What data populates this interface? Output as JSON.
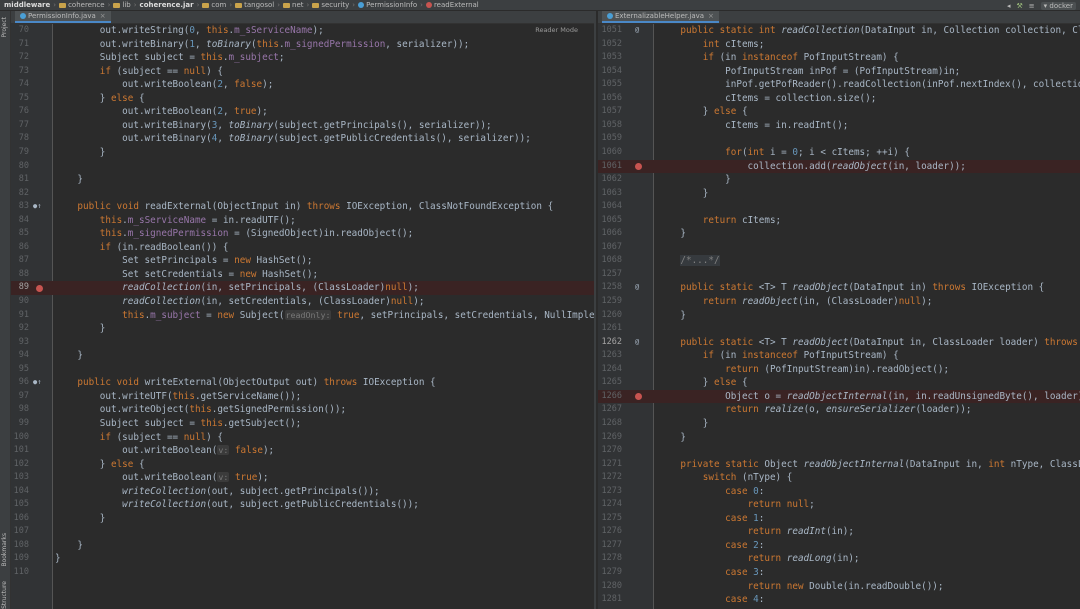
{
  "breadcrumb": [
    "middleware",
    "coherence",
    "lib",
    "coherence.jar",
    "com",
    "tangosol",
    "net",
    "security",
    "PermissionInfo",
    "readExternal"
  ],
  "topbar": {
    "run_config": "docker"
  },
  "side_tabs": {
    "project": "Project",
    "bookmarks": "Bookmarks",
    "structure": "Structure"
  },
  "left_tab": {
    "label": "PermissionInfo.java"
  },
  "right_tab": {
    "label": "ExternalizableHelper.java"
  },
  "reader_mode": "Reader Mode",
  "left_lines": [
    {
      "n": "70",
      "t": "        out.writeString(0, this.m_sServiceName);"
    },
    {
      "n": "71",
      "t": "        out.writeBinary(1, toBinary(this.m_signedPermission, serializer));"
    },
    {
      "n": "72",
      "t": "        Subject subject = this.m_subject;"
    },
    {
      "n": "73",
      "t": "        if (subject == null) {"
    },
    {
      "n": "74",
      "t": "            out.writeBoolean(2, false);"
    },
    {
      "n": "75",
      "t": "        } else {"
    },
    {
      "n": "76",
      "t": "            out.writeBoolean(2, true);"
    },
    {
      "n": "77",
      "t": "            out.writeBinary(3, toBinary(subject.getPrincipals(), serializer));"
    },
    {
      "n": "78",
      "t": "            out.writeBinary(4, toBinary(subject.getPublicCredentials(), serializer));"
    },
    {
      "n": "79",
      "t": "        }"
    },
    {
      "n": "80",
      "t": ""
    },
    {
      "n": "81",
      "t": "    }"
    },
    {
      "n": "82",
      "t": ""
    },
    {
      "n": "83",
      "t": "    public void readExternal(ObjectInput in) throws IOException, ClassNotFoundException {"
    },
    {
      "n": "84",
      "t": "        this.m_sServiceName = in.readUTF();"
    },
    {
      "n": "85",
      "t": "        this.m_signedPermission = (SignedObject)in.readObject();"
    },
    {
      "n": "86",
      "t": "        if (in.readBoolean()) {"
    },
    {
      "n": "87",
      "t": "            Set setPrincipals = new HashSet();"
    },
    {
      "n": "88",
      "t": "            Set setCredentials = new HashSet();"
    },
    {
      "n": "89",
      "t": "            readCollection(in, setPrincipals, (ClassLoader)null);"
    },
    {
      "n": "90",
      "t": "            readCollection(in, setCredentials, (ClassLoader)null);"
    },
    {
      "n": "91",
      "t": "            this.m_subject = new Subject( readOnly: true, setPrincipals, setCredentials, NullImplementa"
    },
    {
      "n": "92",
      "t": "        }"
    },
    {
      "n": "93",
      "t": ""
    },
    {
      "n": "94",
      "t": "    }"
    },
    {
      "n": "95",
      "t": ""
    },
    {
      "n": "96",
      "t": "    public void writeExternal(ObjectOutput out) throws IOException {"
    },
    {
      "n": "97",
      "t": "        out.writeUTF(this.getServiceName());"
    },
    {
      "n": "98",
      "t": "        out.writeObject(this.getSignedPermission());"
    },
    {
      "n": "99",
      "t": "        Subject subject = this.getSubject();"
    },
    {
      "n": "100",
      "t": "        if (subject == null) {"
    },
    {
      "n": "101",
      "t": "            out.writeBoolean( v: false);"
    },
    {
      "n": "102",
      "t": "        } else {"
    },
    {
      "n": "103",
      "t": "            out.writeBoolean( v: true);"
    },
    {
      "n": "104",
      "t": "            writeCollection(out, subject.getPrincipals());"
    },
    {
      "n": "105",
      "t": "            writeCollection(out, subject.getPublicCredentials());"
    },
    {
      "n": "106",
      "t": "        }"
    },
    {
      "n": "107",
      "t": ""
    },
    {
      "n": "108",
      "t": "    }"
    },
    {
      "n": "109",
      "t": "}"
    },
    {
      "n": "110",
      "t": ""
    }
  ],
  "right_lines": [
    {
      "n": "1051",
      "t": "    public static int readCollection(DataInput in, Collection collection, Cla"
    },
    {
      "n": "1052",
      "t": "        int cItems;"
    },
    {
      "n": "1053",
      "t": "        if (in instanceof PofInputStream) {"
    },
    {
      "n": "1054",
      "t": "            PofInputStream inPof = (PofInputStream)in;"
    },
    {
      "n": "1055",
      "t": "            inPof.getPofReader().readCollection(inPof.nextIndex(), collection);"
    },
    {
      "n": "1056",
      "t": "            cItems = collection.size();"
    },
    {
      "n": "1057",
      "t": "        } else {"
    },
    {
      "n": "1058",
      "t": "            cItems = in.readInt();"
    },
    {
      "n": "1059",
      "t": ""
    },
    {
      "n": "1060",
      "t": "            for(int i = 0; i < cItems; ++i) {"
    },
    {
      "n": "1061",
      "t": "                collection.add(readObject(in, loader));"
    },
    {
      "n": "1062",
      "t": "            }"
    },
    {
      "n": "1063",
      "t": "        }"
    },
    {
      "n": "1064",
      "t": ""
    },
    {
      "n": "1065",
      "t": "        return cItems;"
    },
    {
      "n": "1066",
      "t": "    }"
    },
    {
      "n": "1067",
      "t": ""
    },
    {
      "n": "1068",
      "t": "    /*...*/"
    },
    {
      "n": "1257",
      "t": ""
    },
    {
      "n": "1258",
      "t": "    public static <T> T readObject(DataInput in) throws IOException {"
    },
    {
      "n": "1259",
      "t": "        return readObject(in, (ClassLoader)null);"
    },
    {
      "n": "1260",
      "t": "    }"
    },
    {
      "n": "1261",
      "t": ""
    },
    {
      "n": "1262",
      "t": "    public static <T> T readObject(DataInput in, ClassLoader loader) throws I"
    },
    {
      "n": "1263",
      "t": "        if (in instanceof PofInputStream) {"
    },
    {
      "n": "1264",
      "t": "            return (PofInputStream)in).readObject();"
    },
    {
      "n": "1265",
      "t": "        } else {"
    },
    {
      "n": "1266",
      "t": "            Object o = readObjectInternal(in, in.readUnsignedByte(), loader);"
    },
    {
      "n": "1267",
      "t": "            return realize(o, ensureSerializer(loader));"
    },
    {
      "n": "1268",
      "t": "        }"
    },
    {
      "n": "1269",
      "t": "    }"
    },
    {
      "n": "1270",
      "t": ""
    },
    {
      "n": "1271",
      "t": "    private static Object readObjectInternal(DataInput in, int nType, ClassLo"
    },
    {
      "n": "1272",
      "t": "        switch (nType) {"
    },
    {
      "n": "1273",
      "t": "            case 0:"
    },
    {
      "n": "1274",
      "t": "                return null;"
    },
    {
      "n": "1275",
      "t": "            case 1:"
    },
    {
      "n": "1276",
      "t": "                return readInt(in);"
    },
    {
      "n": "1277",
      "t": "            case 2:"
    },
    {
      "n": "1278",
      "t": "                return readLong(in);"
    },
    {
      "n": "1279",
      "t": "            case 3:"
    },
    {
      "n": "1280",
      "t": "                return new Double(in.readDouble());"
    },
    {
      "n": "1281",
      "t": "            case 4:"
    }
  ]
}
